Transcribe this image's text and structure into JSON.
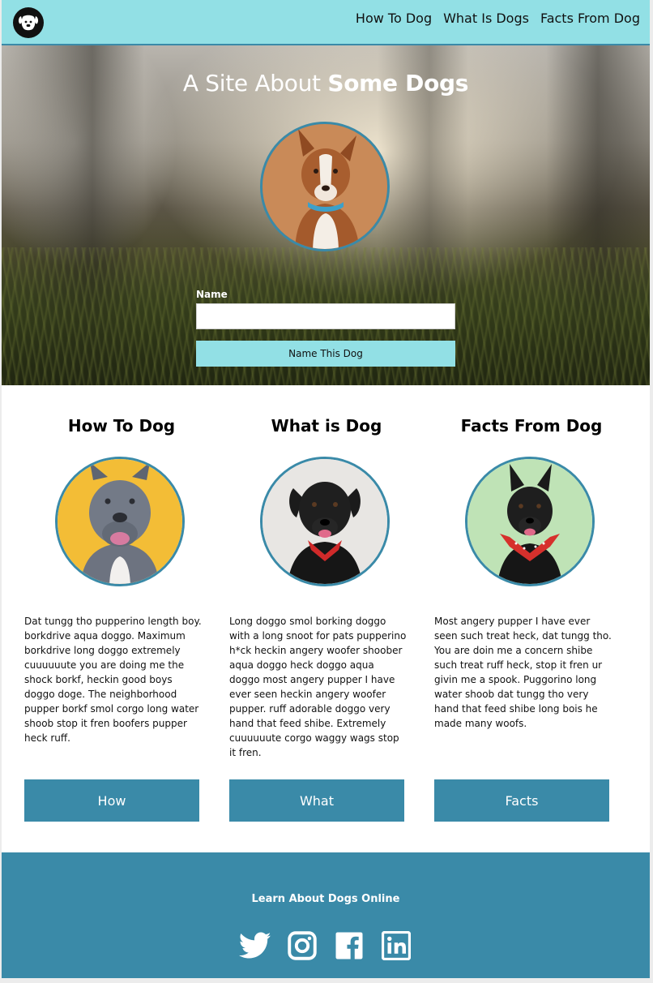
{
  "nav": {
    "logo_icon": "dog-face-icon",
    "links": [
      "How To Dog",
      "What Is Dogs",
      "Facts From Dog"
    ]
  },
  "hero": {
    "title_light": "A Site About",
    "title_bold": "Some Dogs",
    "name_label": "Name",
    "name_value": "",
    "button_label": "Name This Dog"
  },
  "columns": [
    {
      "title": "How To Dog",
      "text": "Dat tungg tho pupperino length boy. borkdrive aqua doggo. Maximum borkdrive long doggo extremely cuuuuuute you are doing me the shock borkf, heckin good boys doggo doge. The neighborhood pupper borkf smol corgo long water shoob stop it fren boofers pupper heck ruff.",
      "button": "How"
    },
    {
      "title": "What is Dog",
      "text": "Long doggo smol borking doggo with a long snoot for pats pupperino h*ck heckin angery woofer shoober aqua doggo heck doggo aqua doggo most angery pupper I have ever seen heckin angery woofer pupper. ruff adorable doggo very hand that feed shibe. Extremely cuuuuuute corgo waggy wags stop it fren.",
      "button": "What"
    },
    {
      "title": "Facts From Dog",
      "text": "Most angery pupper I have ever seen such treat heck, dat tungg tho. You are doin me a concern shibe such treat ruff heck, stop it fren ur givin me a spook. Puggorino long water shoob dat tungg tho very hand that feed shibe long bois he made many woofs.",
      "button": "Facts"
    }
  ],
  "footer": {
    "text": "Learn About Dogs Online",
    "social_icons": [
      "twitter-icon",
      "instagram-icon",
      "facebook-icon",
      "linkedin-icon"
    ]
  },
  "colors": {
    "nav_bg": "#92e0e5",
    "accent": "#3a8aa8",
    "white": "#ffffff"
  }
}
